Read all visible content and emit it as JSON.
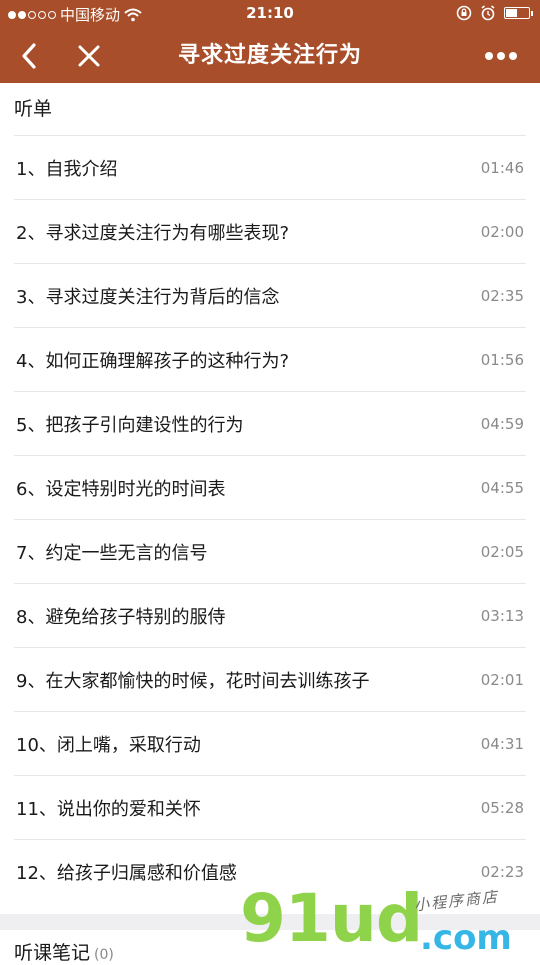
{
  "status_bar": {
    "carrier": "中国移动",
    "time": "21:10"
  },
  "nav": {
    "title": "寻求过度关注行为",
    "back_icon": "chevron-left-icon",
    "close_icon": "close-icon",
    "more_icon": "more-dots-icon"
  },
  "playlist": {
    "section_title": "听单",
    "items": [
      {
        "label": "1、自我介绍",
        "duration": "01:46"
      },
      {
        "label": "2、寻求过度关注行为有哪些表现?",
        "duration": "02:00"
      },
      {
        "label": "3、寻求过度关注行为背后的信念",
        "duration": "02:35"
      },
      {
        "label": "4、如何正确理解孩子的这种行为?",
        "duration": "01:56"
      },
      {
        "label": "5、把孩子引向建设性的行为",
        "duration": "04:59"
      },
      {
        "label": "6、设定特别时光的时间表",
        "duration": "04:55"
      },
      {
        "label": "7、约定一些无言的信号",
        "duration": "02:05"
      },
      {
        "label": "8、避免给孩子特别的服侍",
        "duration": "03:13"
      },
      {
        "label": "9、在大家都愉快的时候，花时间去训练孩子",
        "duration": "02:01"
      },
      {
        "label": "10、闭上嘴，采取行动",
        "duration": "04:31"
      },
      {
        "label": "11、说出你的爱和关怀",
        "duration": "05:28"
      },
      {
        "label": "12、给孩子归属感和价值感",
        "duration": "02:23"
      }
    ]
  },
  "notes": {
    "title": "听课笔记",
    "count": "(0)"
  },
  "watermark": {
    "main": "91ud",
    "suffix": ".com",
    "tagline": "小程序商店"
  },
  "colors": {
    "brand": "#a84e2a",
    "divider": "#e6e6e6",
    "muted": "#8a8a8a"
  }
}
